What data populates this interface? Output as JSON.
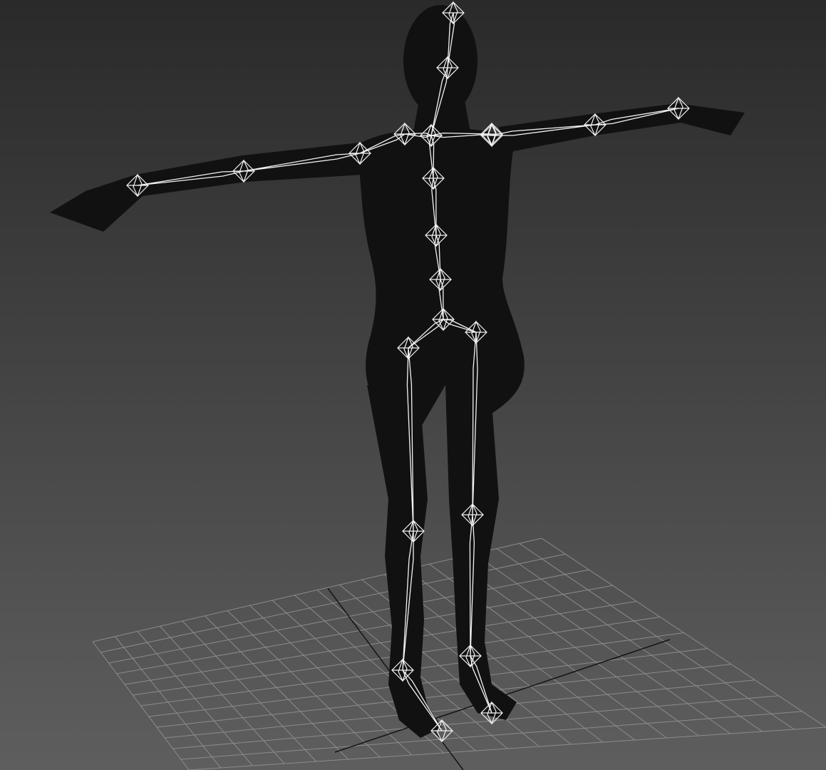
{
  "viewport": {
    "background_top": "#2a2a2a",
    "background_bottom": "#5e5e5e",
    "grid_color": "#8c8c8c",
    "grid_axis_color": "#141414",
    "mesh_color": "#555555",
    "mesh_fill": "#111111",
    "bone_color": "#f2f2f2"
  },
  "scene": {
    "object": "rigged-female-character",
    "display_mode": "wireframe",
    "pose": "t-pose",
    "skeleton_visible": true,
    "ground_grid_visible": true
  }
}
